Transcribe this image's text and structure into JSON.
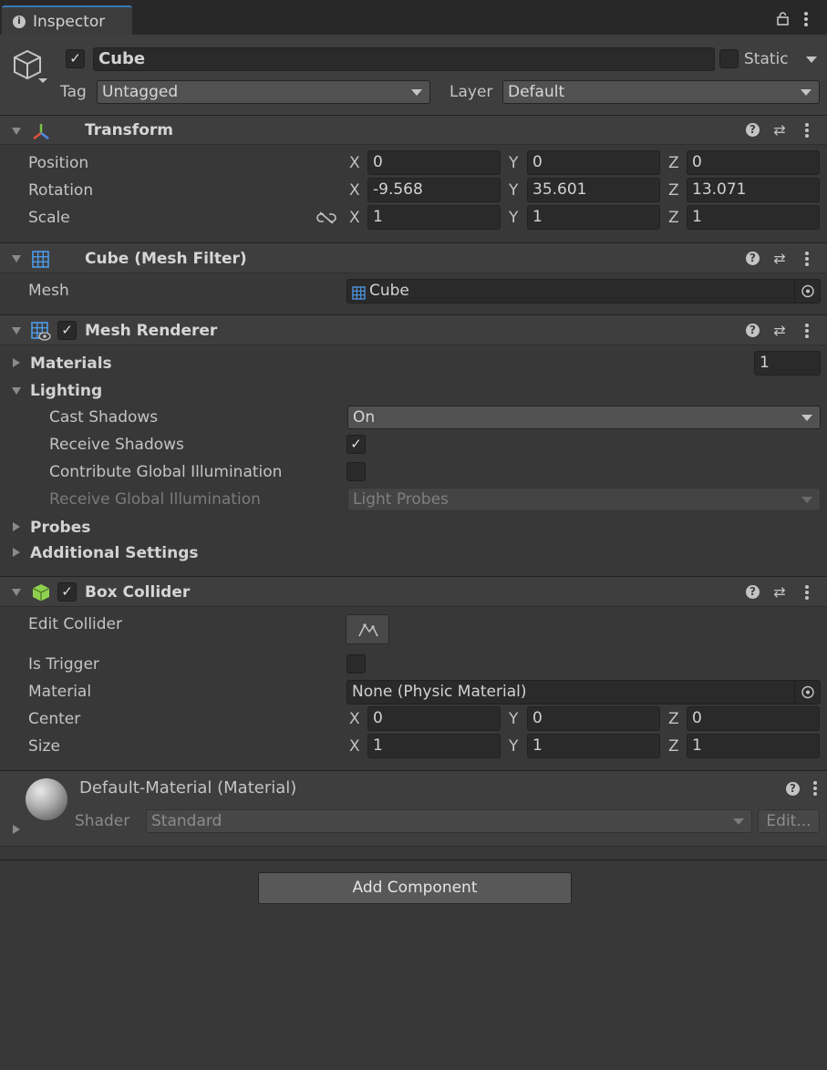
{
  "tab": {
    "label": "Inspector",
    "icon": "info-icon"
  },
  "gameobject": {
    "name": "Cube",
    "active": true,
    "static_label": "Static",
    "tag_label": "Tag",
    "tag_value": "Untagged",
    "layer_label": "Layer",
    "layer_value": "Default"
  },
  "transform": {
    "title": "Transform",
    "rows": [
      {
        "label": "Position",
        "x": "0",
        "y": "0",
        "z": "0"
      },
      {
        "label": "Rotation",
        "x": "-9.568",
        "y": "35.601",
        "z": "13.071"
      },
      {
        "label": "Scale",
        "x": "1",
        "y": "1",
        "z": "1"
      }
    ]
  },
  "axes": {
    "x": "X",
    "y": "Y",
    "z": "Z"
  },
  "mesh_filter": {
    "title": "Cube (Mesh Filter)",
    "mesh_label": "Mesh",
    "mesh_value": "Cube"
  },
  "mesh_renderer": {
    "title": "Mesh Renderer",
    "enabled": true,
    "materials_label": "Materials",
    "materials_count": "1",
    "lighting_label": "Lighting",
    "cast_shadows_label": "Cast Shadows",
    "cast_shadows_value": "On",
    "receive_shadows_label": "Receive Shadows",
    "receive_shadows": true,
    "contribute_gi_label": "Contribute Global Illumination",
    "contribute_gi": false,
    "receive_gi_label": "Receive Global Illumination",
    "receive_gi_value": "Light Probes",
    "probes_label": "Probes",
    "additional_label": "Additional Settings"
  },
  "box_collider": {
    "title": "Box Collider",
    "enabled": true,
    "edit_collider_label": "Edit Collider",
    "is_trigger_label": "Is Trigger",
    "is_trigger": false,
    "material_label": "Material",
    "material_value": "None (Physic Material)",
    "center_label": "Center",
    "center": {
      "x": "0",
      "y": "0",
      "z": "0"
    },
    "size_label": "Size",
    "size": {
      "x": "1",
      "y": "1",
      "z": "1"
    }
  },
  "material": {
    "title": "Default-Material (Material)",
    "shader_label": "Shader",
    "shader_value": "Standard",
    "edit_label": "Edit..."
  },
  "add_component_label": "Add Component",
  "colors": {
    "background": "#383838",
    "header": "#3e3e3e",
    "field": "#2a2a2a",
    "collider_icon": "#8fd14f",
    "transform_red": "#e0533a",
    "transform_green": "#7ac143",
    "transform_blue": "#4e8be8"
  }
}
